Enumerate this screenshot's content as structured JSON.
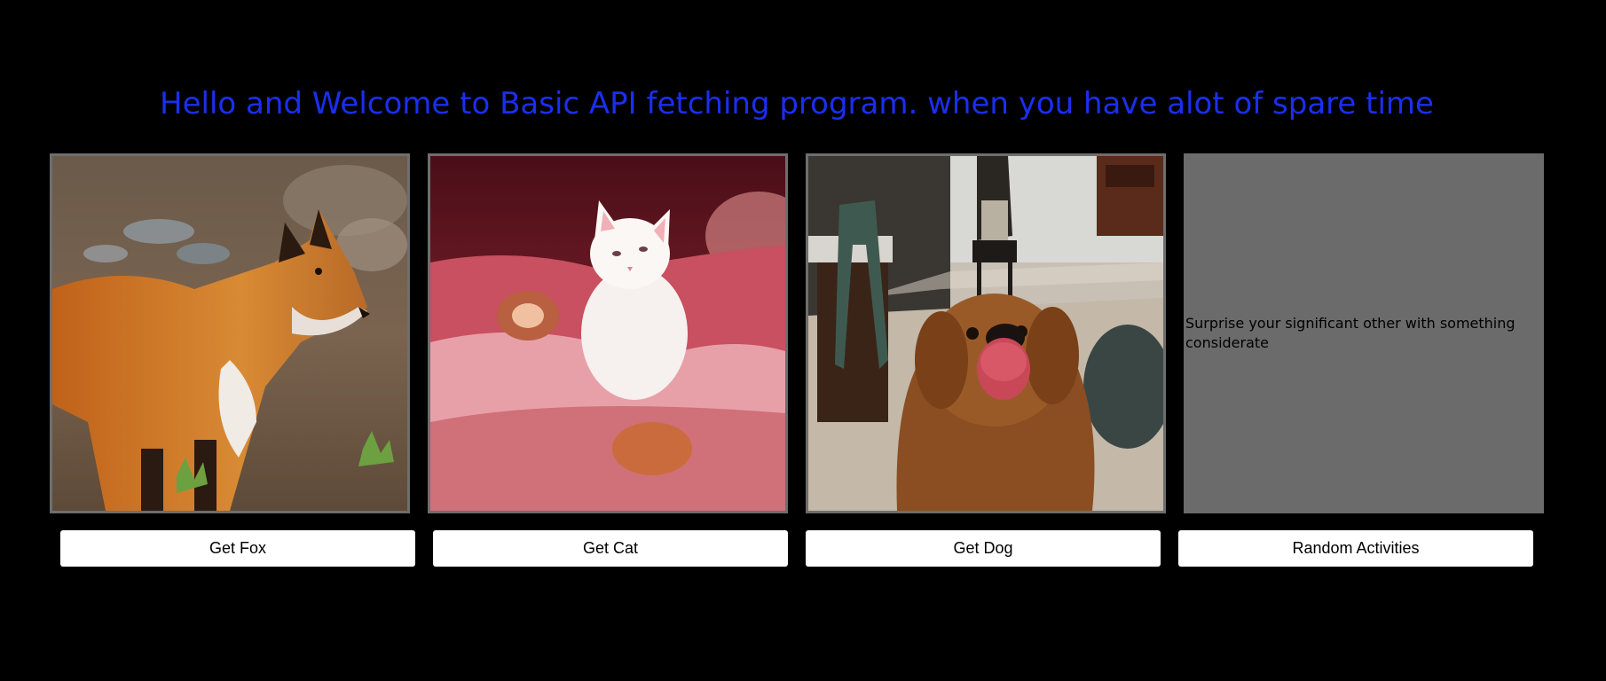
{
  "header": {
    "title": "Hello and Welcome to Basic API fetching program. when you have alot of spare time",
    "title_color": "#1a2ff0"
  },
  "cards": {
    "fox": {
      "image": "fox-photo"
    },
    "cat": {
      "image": "kitten-photo"
    },
    "dog": {
      "image": "dog-photo"
    },
    "activity": {
      "text": "Surprise your significant other with something considerate"
    }
  },
  "buttons": {
    "fox": "Get Fox",
    "cat": "Get Cat",
    "dog": "Get Dog",
    "activity": "Random Activities"
  },
  "colors": {
    "background": "#000000",
    "card_border": "#6e6e6e",
    "activity_panel": "#6b6b6b",
    "button_bg": "#ffffff"
  }
}
